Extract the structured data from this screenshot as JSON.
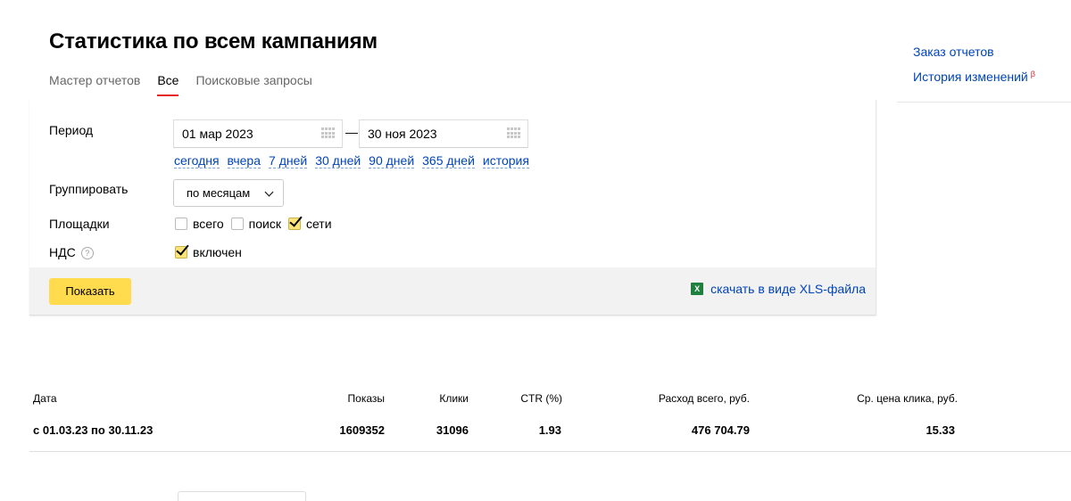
{
  "page": {
    "title": "Статистика по всем кампаниям"
  },
  "tabs": [
    {
      "label": "Мастер отчетов",
      "active": false
    },
    {
      "label": "Все",
      "active": true
    },
    {
      "label": "Поисковые запросы",
      "active": false
    }
  ],
  "right_panel": {
    "order_reports": "Заказ отчетов",
    "change_history": "История изменений",
    "beta_badge": "β"
  },
  "form": {
    "period_label": "Период",
    "date_from": "01 мар 2023",
    "date_separator": "—",
    "date_to": "30 ноя 2023",
    "quick_links": [
      "сегодня",
      "вчера",
      "7 дней",
      "30 дней",
      "90 дней",
      "365 дней",
      "история"
    ],
    "group_label": "Группировать",
    "group_value": "по месяцам",
    "platforms_label": "Площадки",
    "platforms": [
      {
        "label": "всего",
        "checked": false
      },
      {
        "label": "поиск",
        "checked": false
      },
      {
        "label": "сети",
        "checked": true
      }
    ],
    "vat_label": "НДС",
    "vat_help": "?",
    "vat_option": {
      "label": "включен",
      "checked": true
    },
    "show_button": "Показать",
    "xls_icon": "X",
    "xls_link": "скачать в виде XLS-файла"
  },
  "table": {
    "headers": {
      "date": "Дата",
      "impressions": "Показы",
      "clicks": "Клики",
      "ctr": "CTR (%)",
      "spend": "Расход всего, руб.",
      "cpc": "Ср. цена клика, руб."
    },
    "rows": [
      {
        "date": "с 01.03.23 по 30.11.23",
        "impressions": "1609352",
        "clicks": "31096",
        "ctr": "1.93",
        "spend": "476 704.79",
        "cpc": "15.33"
      }
    ]
  },
  "colors": {
    "accent_link": "#0044bb",
    "active_tab_underline": "#e52424",
    "primary_button": "#ffdb4d",
    "checkbox_checked": "#fde479",
    "footer_bg": "#f2f2f2"
  }
}
